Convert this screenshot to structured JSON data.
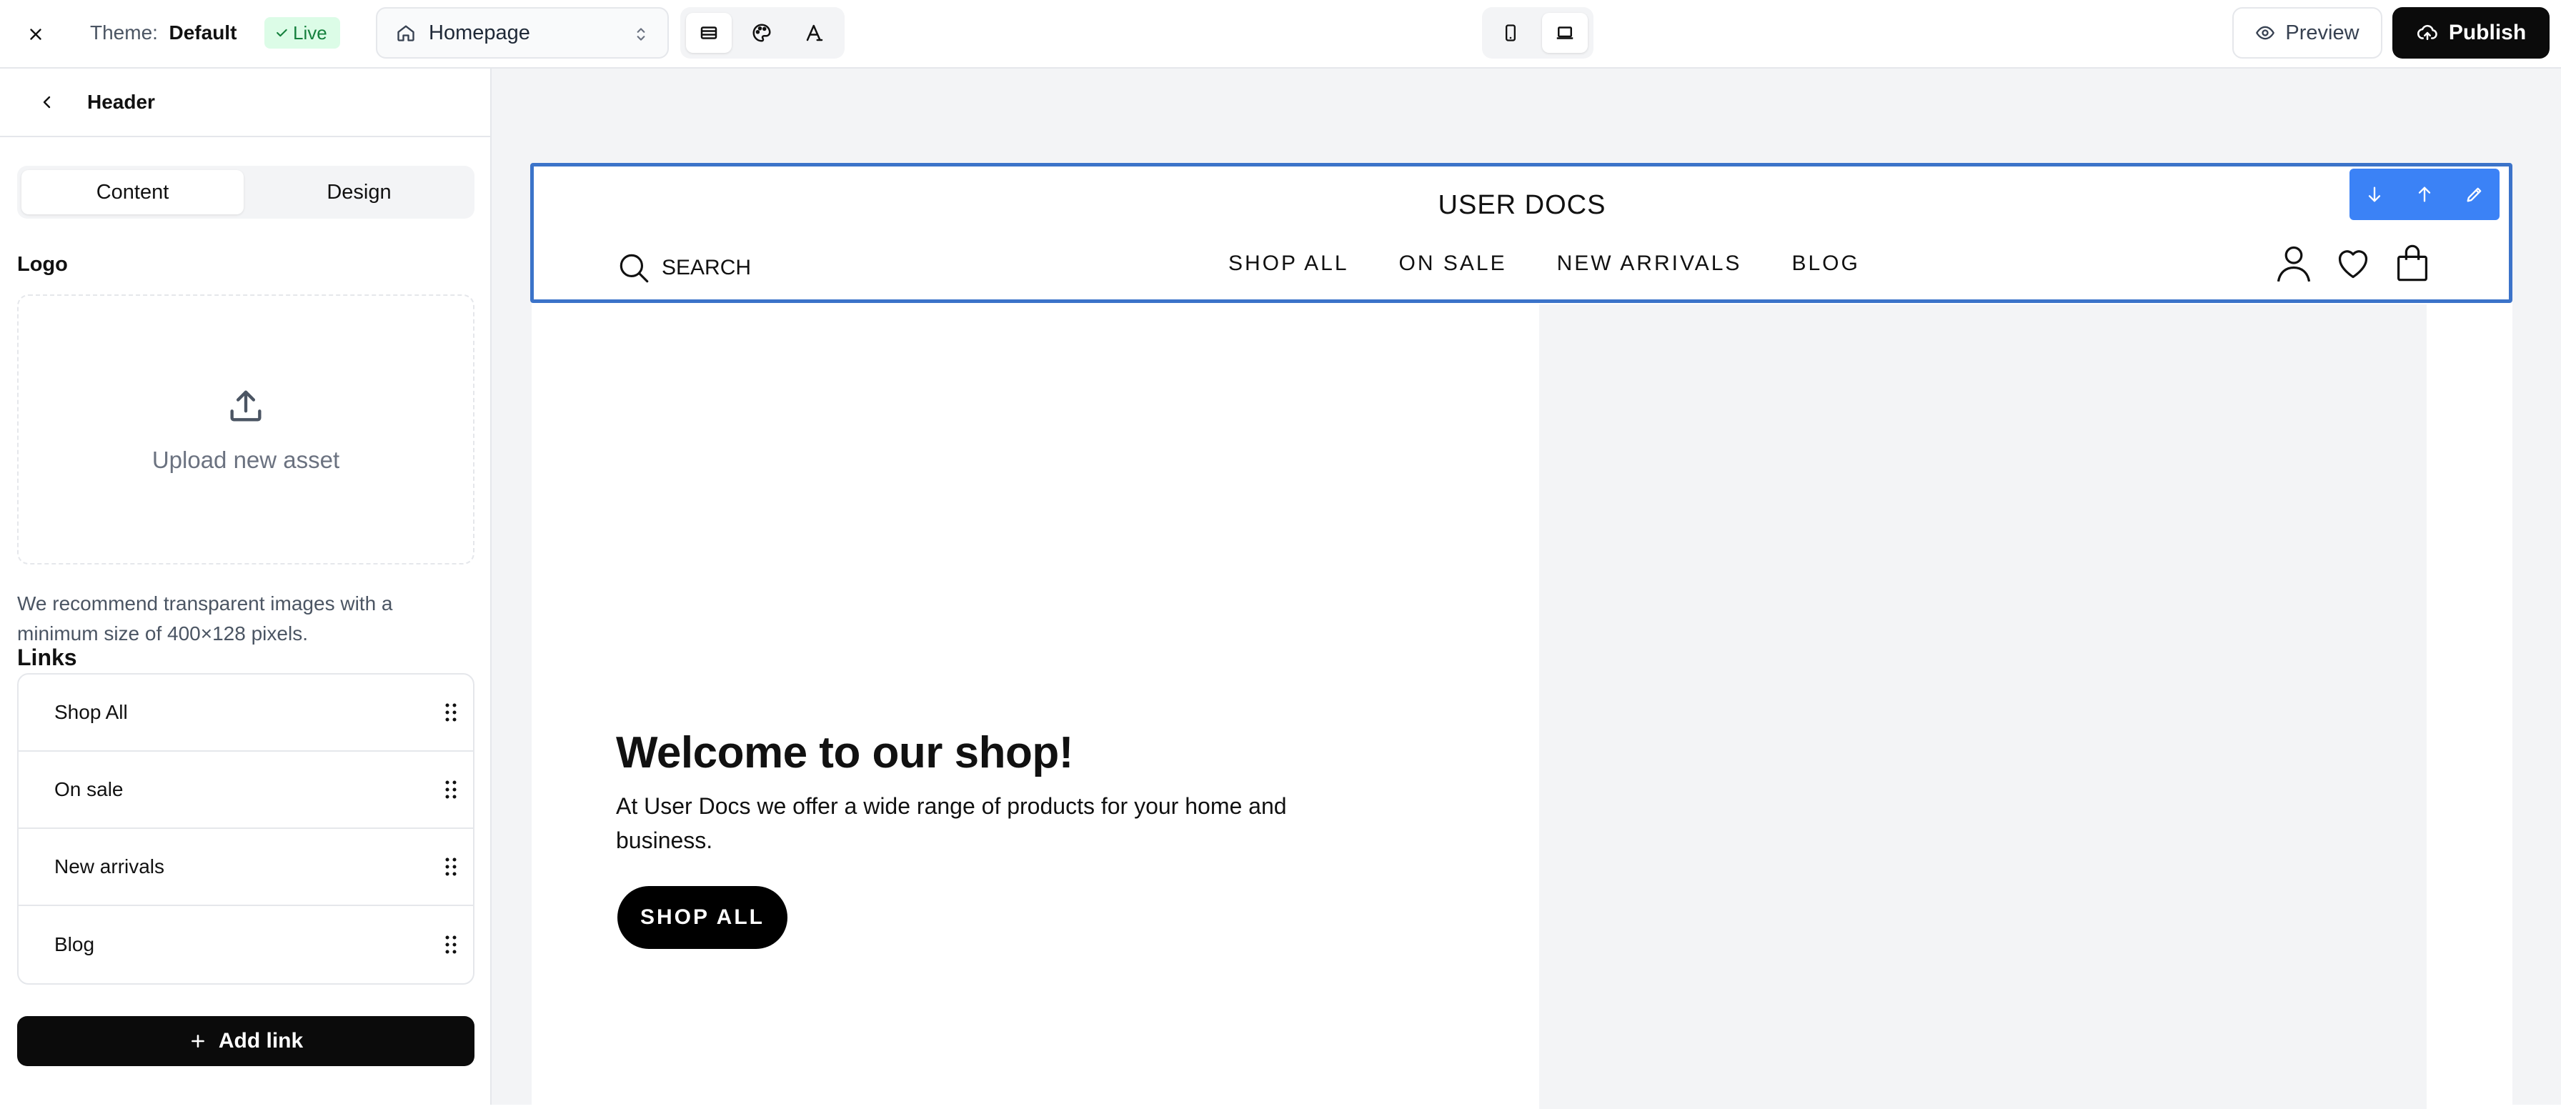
{
  "topbar": {
    "theme_prefix": "Theme:",
    "theme_name": "Default",
    "live_badge": "Live",
    "page_select_value": "Homepage",
    "preview_label": "Preview",
    "publish_label": "Publish"
  },
  "sidebar": {
    "title": "Header",
    "tabs": [
      {
        "label": "Content",
        "active": true
      },
      {
        "label": "Design",
        "active": false
      }
    ],
    "logo_label": "Logo",
    "upload_label": "Upload new asset",
    "logo_hint": "We recommend transparent images with a minimum size of 400×128 pixels.",
    "links_label": "Links",
    "links": [
      {
        "label": "Shop All"
      },
      {
        "label": "On sale"
      },
      {
        "label": "New arrivals"
      },
      {
        "label": "Blog"
      }
    ],
    "add_link_label": "Add link"
  },
  "preview": {
    "site_title": "USER DOCS",
    "search_label": "SEARCH",
    "nav": [
      "SHOP ALL",
      "ON SALE",
      "NEW ARRIVALS",
      "BLOG"
    ],
    "hero_title": "Welcome to our shop!",
    "hero_subtitle": "At User Docs we offer a wide range of products for your home and business.",
    "hero_button": "SHOP ALL"
  },
  "colors": {
    "accent": "#3b82f6",
    "selection": "#3b73c9",
    "live_bg": "#dcfce7",
    "live_text": "#15803d",
    "primary_button": "#0b0b0b",
    "canvas_bg": "#f3f4f6"
  }
}
